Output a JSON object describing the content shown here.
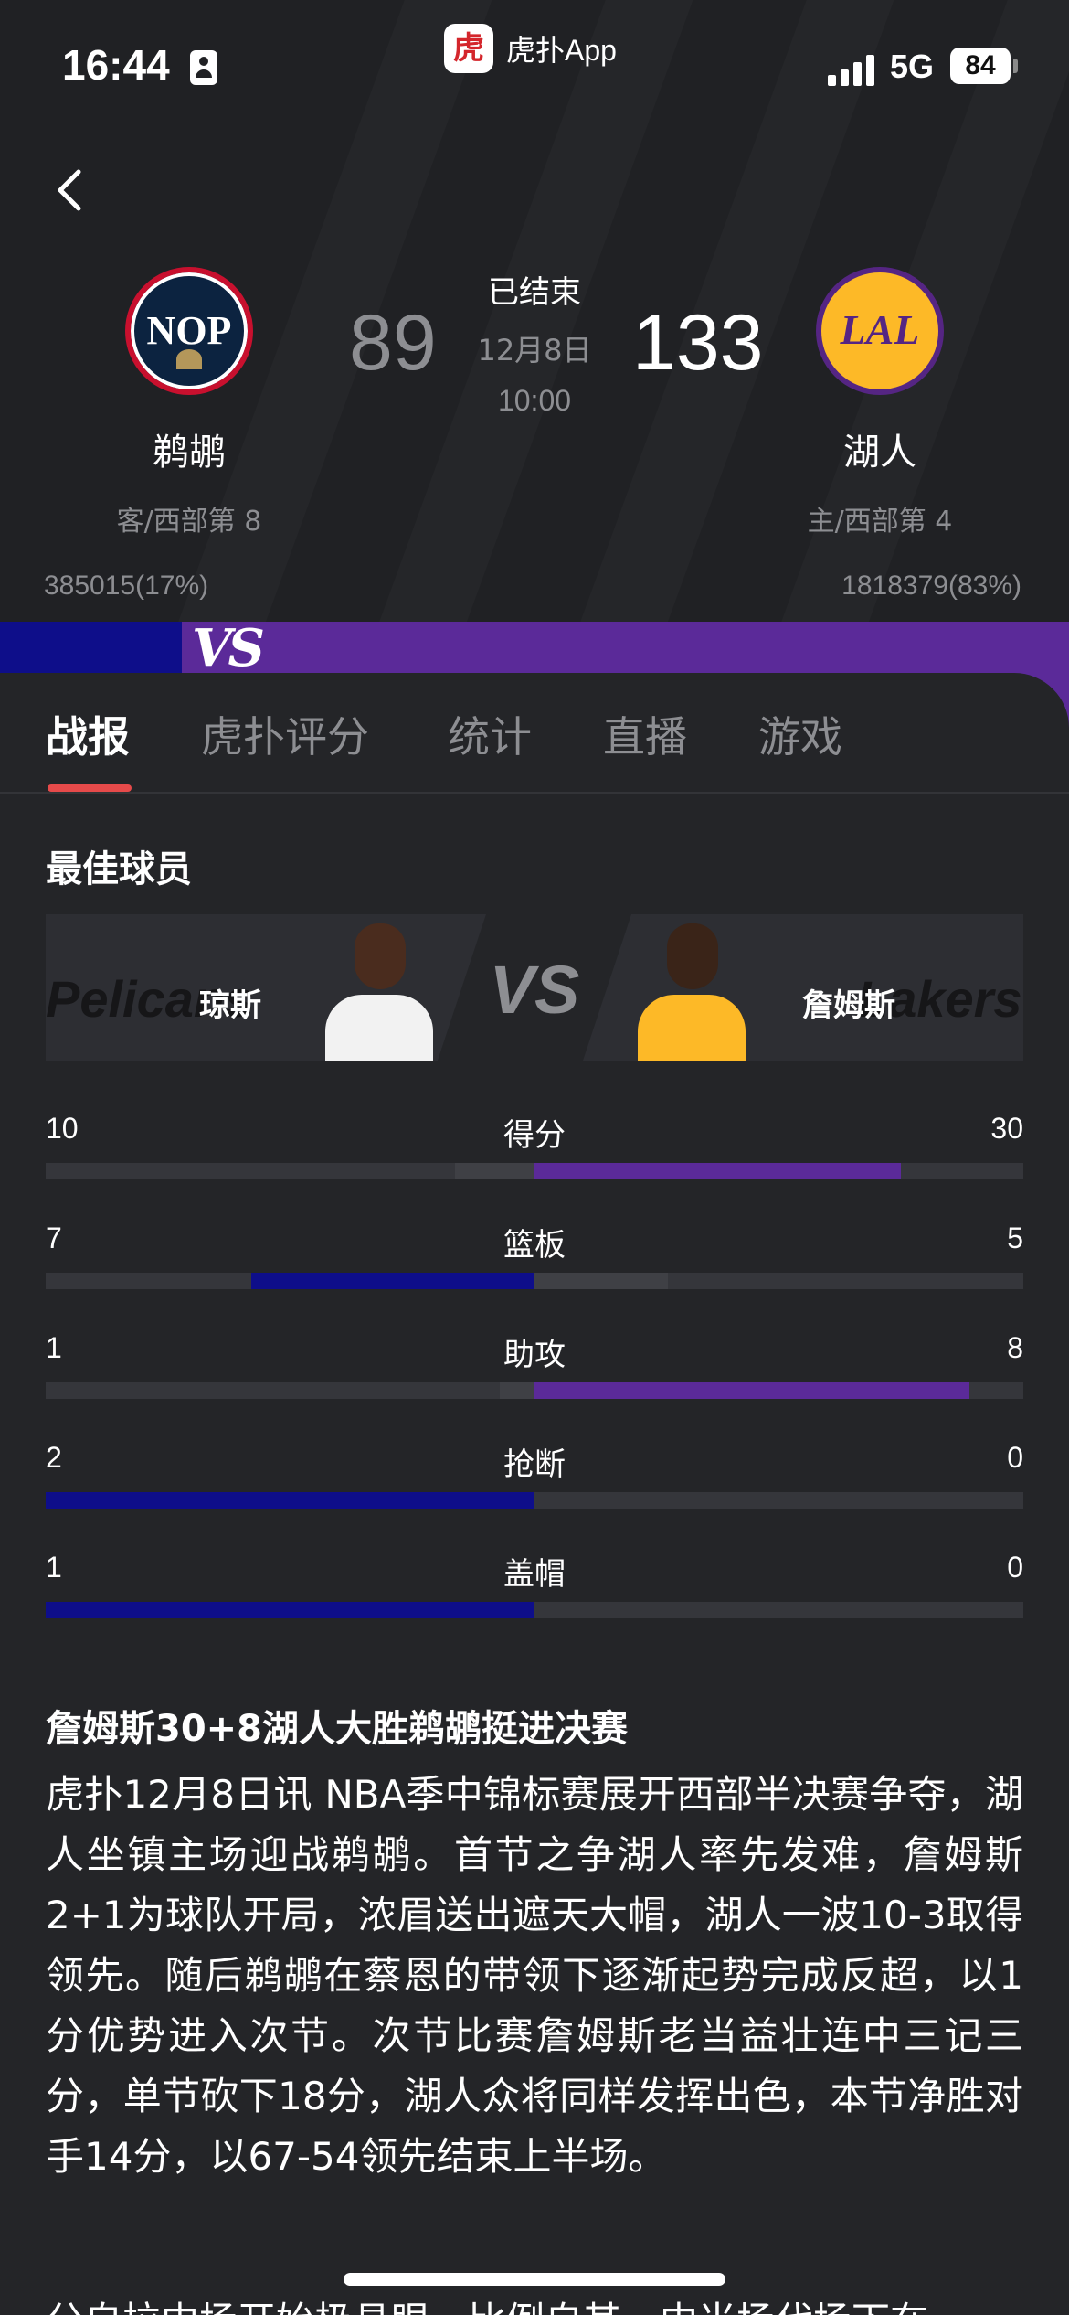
{
  "status_bar": {
    "time": "16:44",
    "app_name": "虎扑App",
    "app_logo_char": "虎",
    "network": "5G",
    "battery": "84"
  },
  "game": {
    "away": {
      "logo_text": "NOP",
      "name": "鹈鹕",
      "rank": "客/西部第 8",
      "score": "89",
      "support": "385015(17%)",
      "support_pct": 17,
      "color": "#0e0e8a"
    },
    "home": {
      "logo_text": "LAL",
      "name": "湖人",
      "rank": "主/西部第 4",
      "score": "133",
      "support": "1818379(83%)",
      "support_pct": 83,
      "color": "#5b2a99"
    },
    "status": "已结束",
    "date": "12月8日",
    "time": "10:00",
    "vs_mark": "VS"
  },
  "tabs": [
    "战报",
    "虎扑评分",
    "统计",
    "直播",
    "游戏"
  ],
  "best_players": {
    "title": "最佳球员",
    "vs": "VS",
    "away": {
      "name": "琼斯",
      "watermark": "Pelicans"
    },
    "home": {
      "name": "詹姆斯",
      "watermark": "Lakers"
    }
  },
  "stats": [
    {
      "label": "得分",
      "away": "10",
      "home": "30",
      "fraction": 0.75,
      "leader": "home"
    },
    {
      "label": "篮板",
      "away": "7",
      "home": "5",
      "fraction": 0.58,
      "leader": "away"
    },
    {
      "label": "助攻",
      "away": "1",
      "home": "8",
      "fraction": 0.89,
      "leader": "home"
    },
    {
      "label": "抢断",
      "away": "2",
      "home": "0",
      "fraction": 1.0,
      "leader": "away"
    },
    {
      "label": "盖帽",
      "away": "1",
      "home": "0",
      "fraction": 1.0,
      "leader": "away"
    }
  ],
  "article": {
    "title": "詹姆斯30+8湖人大胜鹈鹕挺进决赛",
    "body": "虎扑12月8日讯 NBA季中锦标赛展开西部半决赛争夺，湖人坐镇主场迎战鹈鹕。首节之争湖人率先发难，詹姆斯2+1为球队开局，浓眉送出遮天大帽，湖人一波10-3取得领先。随后鹈鹕在蔡恩的带领下逐渐起势完成反超，以1分优势进入次节。次节比赛詹姆斯老当益壮连中三记三分，单节砍下18分，湖人众将同样发挥出色，本节净胜对手14分，以67-54领先结束上半场。",
    "next_line": "分自拉中场开始极具眼，比例自其一中当场代场下在"
  }
}
